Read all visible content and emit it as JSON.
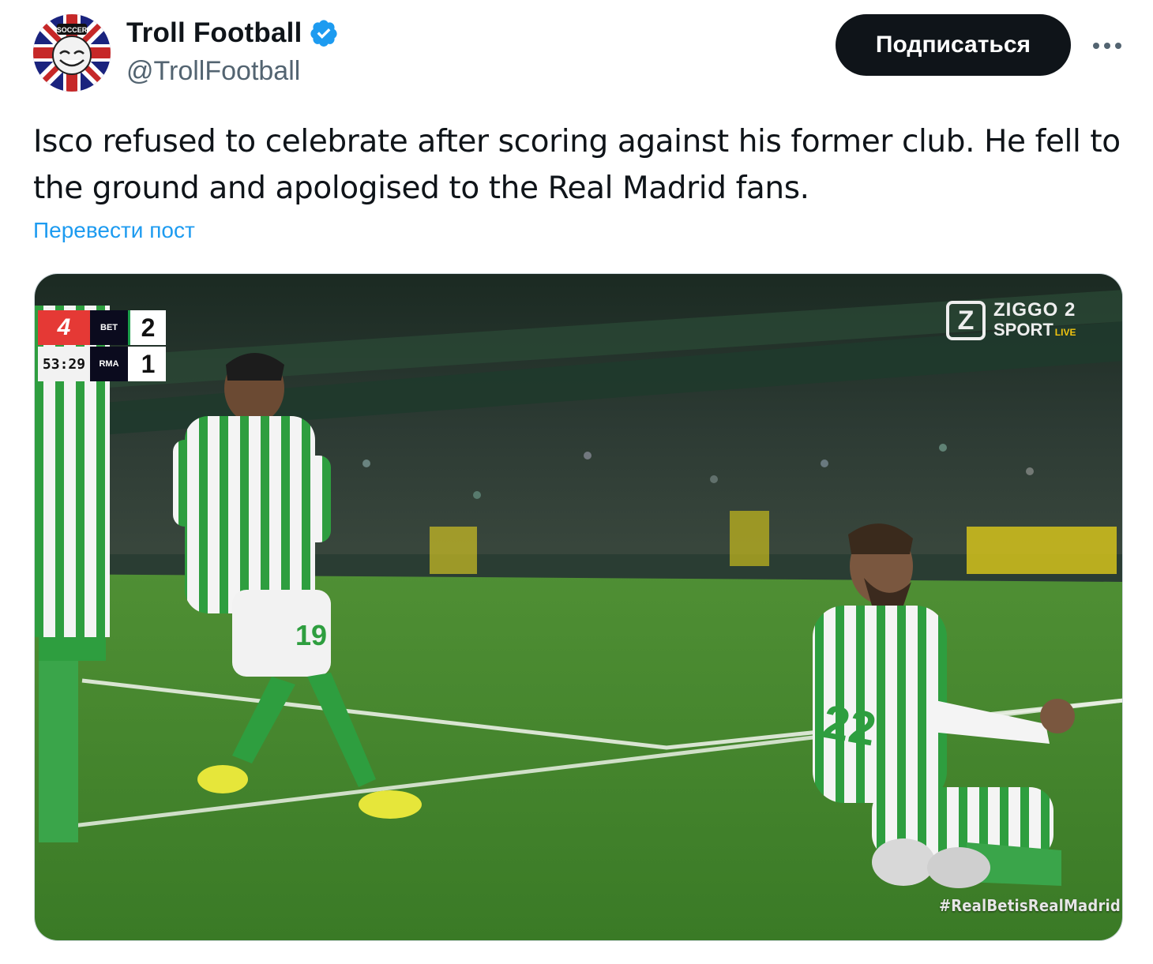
{
  "author": {
    "name": "Troll Football",
    "handle": "@TrollFootball",
    "verified": true,
    "avatar_icon": "troll-football-logo",
    "avatar_logo_text": "SOCCER"
  },
  "actions": {
    "follow_label": "Подписаться",
    "more_icon": "more-horizontal-icon"
  },
  "tweet": {
    "text": "Isco refused to celebrate after scoring against his former club. He fell to the ground and apologised to the Real Madrid fans.",
    "translate_label": "Перевести пост"
  },
  "media": {
    "scoreboard": {
      "league_logo": "4",
      "clock": "53:29",
      "home_team": "BET",
      "home_score": "2",
      "away_team": "RMA",
      "away_score": "1"
    },
    "broadcaster": {
      "logo_letter": "Z",
      "line1": "ZIGGO 2",
      "line2": "SPORT",
      "live": "LIVE"
    },
    "hashtag": "#RealBetisRealMadrid",
    "jersey_numbers": [
      "19",
      "22"
    ]
  },
  "colors": {
    "link": "#1d9bf0",
    "follow_bg": "#0f1419",
    "handle": "#536471",
    "verified": "#1d9bf0",
    "pitch": "#3f8a2b"
  }
}
